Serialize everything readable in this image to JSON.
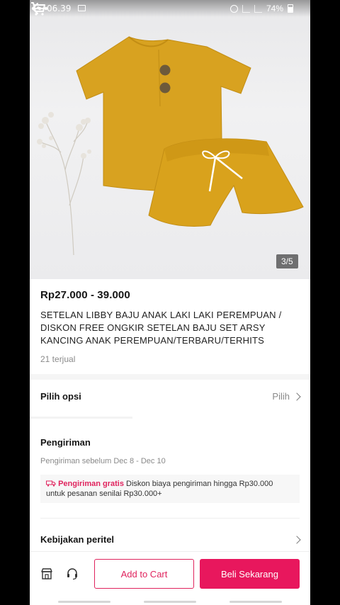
{
  "status_bar": {
    "time": "06.39",
    "battery": "74%"
  },
  "hero": {
    "image_counter": "3/5"
  },
  "product": {
    "price": "Rp27.000 - 39.000",
    "title": "SETELAN LIBBY BAJU ANAK LAKI LAKI PEREMPUAN / DISKON FREE ONGKIR SETELAN BAJU SET ARSY KANCING ANAK PEREMPUAN/TERBARU/TERHITS",
    "sold": "21 terjual"
  },
  "options": {
    "label": "Pilih opsi",
    "action": "Pilih"
  },
  "shipping": {
    "title": "Pengiriman",
    "estimate": "Pengiriman sebelum Dec 8 - Dec 10",
    "promo_highlight": "Pengiriman gratis",
    "promo_text": "Diskon biaya pengiriman hingga Rp30.000 untuk pesanan senilai Rp30.000+"
  },
  "policy": {
    "label": "Kebijakan peritel"
  },
  "bottom_bar": {
    "add_to_cart": "Add to Cart",
    "buy_now": "Beli Sekarang"
  },
  "colors": {
    "accent": "#e8175d",
    "garment": "#d9a21c"
  }
}
